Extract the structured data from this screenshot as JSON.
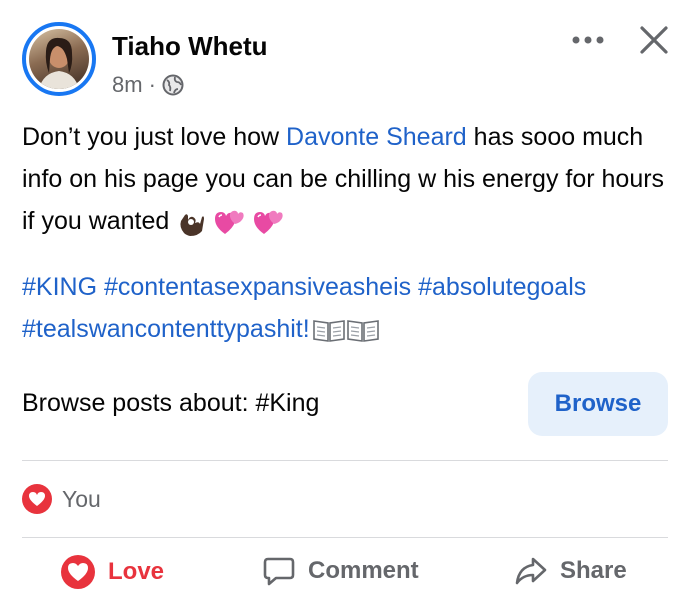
{
  "post": {
    "author": "Tiaho Whetu",
    "time": "8m",
    "separator": "·",
    "text_before": "Don’t you just love how ",
    "mention": "Davonte Sheard",
    "text_after": " has sooo much info on his page you can be chilling w his energy for hours if you wanted",
    "hashtags_line1": "#KING #contentasexpansiveasheis #absolutegoals",
    "hashtags_line2": "#tealswancontenttypashit!",
    "browse_label": "Browse posts about: #King",
    "browse_button": "Browse",
    "reaction_summary": "You"
  },
  "actions": {
    "love": "Love",
    "comment": "Comment",
    "share": "Share"
  },
  "colors": {
    "link": "#1f62c9",
    "love": "#e8333d",
    "muted": "#65676b",
    "browse_bg": "#e6f0fb",
    "avatar_ring": "#1877f2"
  },
  "icons": [
    "more-icon",
    "close-icon",
    "globe-icon",
    "ok-hand-emoji",
    "heart-emoji",
    "book-emoji",
    "love-icon",
    "comment-icon",
    "share-icon"
  ]
}
